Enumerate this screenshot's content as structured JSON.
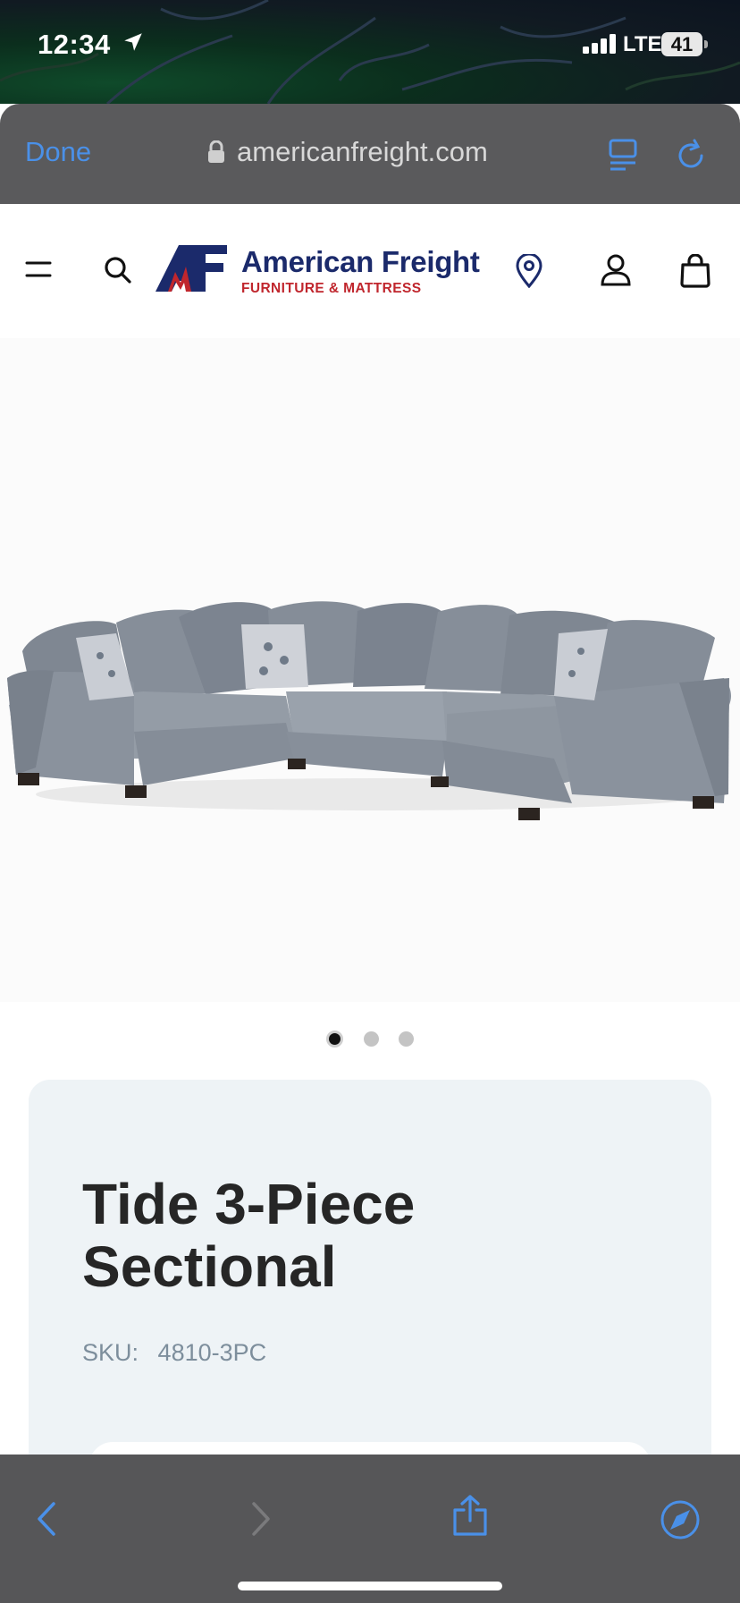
{
  "status_bar": {
    "time": "12:34",
    "network": "LTE",
    "battery": "41",
    "icons": [
      "location-arrow-icon",
      "cellular-signal-icon",
      "battery-icon"
    ]
  },
  "browser": {
    "done_label": "Done",
    "url": "americanfreight.com",
    "icons": [
      "lock-icon",
      "reader-view-icon",
      "reload-icon"
    ],
    "accent_color": "#4a90e8"
  },
  "site_header": {
    "logo": {
      "name": "American Freight",
      "tagline": "FURNITURE & MATTRESS",
      "brand_blue": "#1b2a6b",
      "brand_red": "#c0262d"
    },
    "icons": [
      "menu-icon",
      "search-icon",
      "location-pin-icon",
      "account-icon",
      "shopping-bag-icon"
    ]
  },
  "product": {
    "image": "gray-sectional-sofa",
    "carousel": {
      "count": 3,
      "active_index": 0
    },
    "title": "Tide 3-Piece Sectional",
    "sku_label": "SKU:",
    "sku_value": "4810-3PC"
  },
  "toolbar": {
    "icons": [
      "back-icon",
      "forward-icon",
      "share-icon",
      "compass-icon"
    ],
    "forward_enabled": false
  }
}
